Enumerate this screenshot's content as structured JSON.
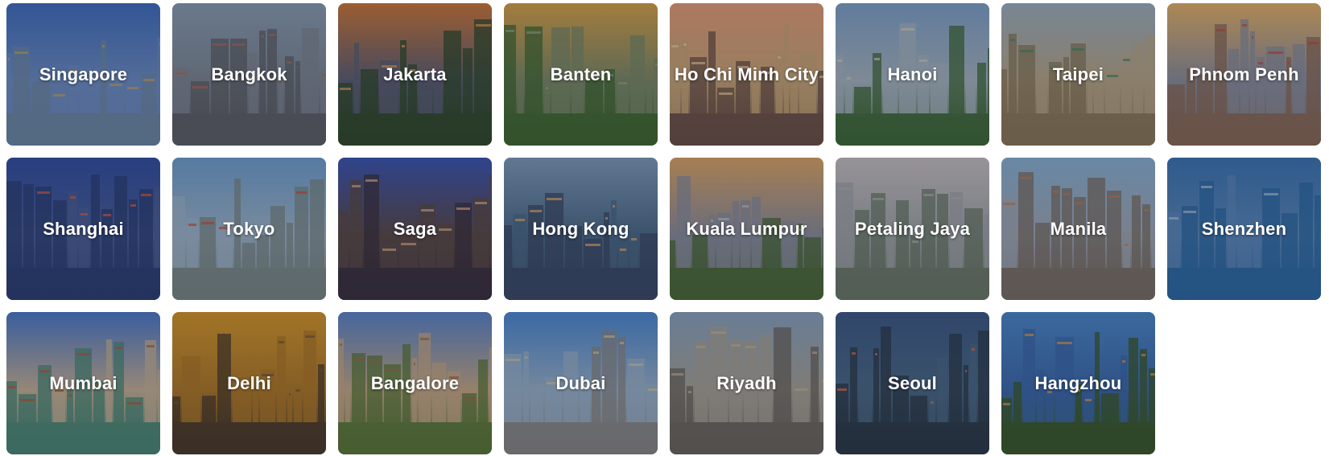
{
  "cities": [
    {
      "id": "singapore",
      "name": "Singapore",
      "sky": "#3f6fc4",
      "mid": "#6c8fc9",
      "ground": "#6d8aa8",
      "accent": "#c9a46a"
    },
    {
      "id": "bangkok",
      "name": "Bangkok",
      "sky": "#8aa0b8",
      "mid": "#7d8796",
      "ground": "#5c6068",
      "accent": "#b36b58"
    },
    {
      "id": "jakarta",
      "name": "Jakarta",
      "sky": "#d07a3c",
      "mid": "#5a5f77",
      "ground": "#2f4a2c",
      "accent": "#e8a15a"
    },
    {
      "id": "banten",
      "name": "Banten",
      "sky": "#d9a54b",
      "mid": "#7a8a6a",
      "ground": "#3f6a33",
      "accent": "#9aa58f"
    },
    {
      "id": "ho-chi-minh-city",
      "name": "Ho Chi Minh City",
      "sky": "#e8a07a",
      "mid": "#c9a77a",
      "ground": "#6a5048",
      "accent": "#f0d3a0"
    },
    {
      "id": "hanoi",
      "name": "Hanoi",
      "sky": "#7fa4cf",
      "mid": "#a7b7c4",
      "ground": "#3d6a3a",
      "accent": "#d6d2c8"
    },
    {
      "id": "taipei",
      "name": "Taipei",
      "sky": "#9fb2c4",
      "mid": "#b8a88a",
      "ground": "#8a7a5c",
      "accent": "#3f8a6a"
    },
    {
      "id": "phnom-penh",
      "name": "Phnom Penh",
      "sky": "#e8b56a",
      "mid": "#8a8fa0",
      "ground": "#8a6a5a",
      "accent": "#c84a3a"
    },
    {
      "id": "shanghai",
      "name": "Shanghai",
      "sky": "#2f4fa8",
      "mid": "#4a5f9a",
      "ground": "#2a3f78",
      "accent": "#e0604a"
    },
    {
      "id": "tokyo",
      "name": "Tokyo",
      "sky": "#6fa2d6",
      "mid": "#9fb8cf",
      "ground": "#7a8a8a",
      "accent": "#d0503a"
    },
    {
      "id": "saga",
      "name": "Saga",
      "sky": "#3a56b8",
      "mid": "#5a4a4a",
      "ground": "#3a3040",
      "accent": "#e0b58a"
    },
    {
      "id": "hong-kong",
      "name": "Hong Kong",
      "sky": "#7f9ec0",
      "mid": "#4a6a8a",
      "ground": "#3a4a6a",
      "accent": "#e8b06a"
    },
    {
      "id": "kuala-lumpur",
      "name": "Kuala Lumpur",
      "sky": "#e0a86a",
      "mid": "#8a8fa0",
      "ground": "#4a6a3a",
      "accent": "#c0c8d0"
    },
    {
      "id": "petaling-jaya",
      "name": "Petaling Jaya",
      "sky": "#c9c4c8",
      "mid": "#a0a6ac",
      "ground": "#6a7a6a",
      "accent": "#b0b4b8"
    },
    {
      "id": "manila",
      "name": "Manila",
      "sky": "#8ab4da",
      "mid": "#a0aab8",
      "ground": "#7a7068",
      "accent": "#c87a4a"
    },
    {
      "id": "shenzhen",
      "name": "Shenzhen",
      "sky": "#3a76b8",
      "mid": "#5a8ac0",
      "ground": "#2a6aa8",
      "accent": "#b8c8d8"
    },
    {
      "id": "mumbai",
      "name": "Mumbai",
      "sky": "#4a7ad0",
      "mid": "#c8b49a",
      "ground": "#4a8a7a",
      "accent": "#b85a3a"
    },
    {
      "id": "delhi",
      "name": "Delhi",
      "sky": "#d89a2a",
      "mid": "#b07a2a",
      "ground": "#4a3a2a",
      "accent": "#6a5a3a"
    },
    {
      "id": "bangalore",
      "name": "Bangalore",
      "sky": "#5a86d0",
      "mid": "#c8ab8a",
      "ground": "#5a7a3a",
      "accent": "#a06a4a"
    },
    {
      "id": "dubai",
      "name": "Dubai",
      "sky": "#4a8ad8",
      "mid": "#9ab4cf",
      "ground": "#8a8a8a",
      "accent": "#d8c8a8"
    },
    {
      "id": "riyadh",
      "name": "Riyadh",
      "sky": "#8aa6c4",
      "mid": "#a8a49a",
      "ground": "#6a6660",
      "accent": "#c8b89a"
    },
    {
      "id": "seoul",
      "name": "Seoul",
      "sky": "#3a5a8a",
      "mid": "#4a6a8a",
      "ground": "#2a3a4a",
      "accent": "#e8704a"
    },
    {
      "id": "hangzhou",
      "name": "Hangzhou",
      "sky": "#4a8ad0",
      "mid": "#3a6ab0",
      "ground": "#3a5a2a",
      "accent": "#e8a04a"
    }
  ]
}
